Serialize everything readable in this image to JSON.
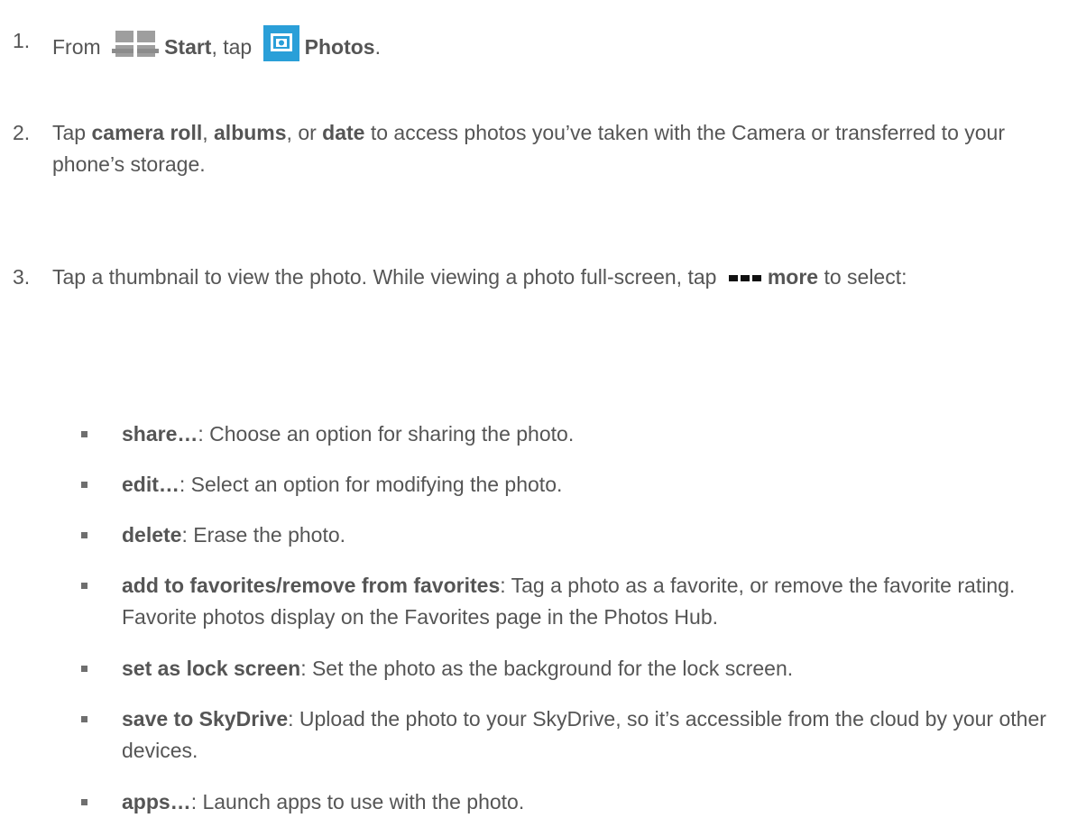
{
  "step1": {
    "num": "1.",
    "from": "From",
    "start": "Start",
    "mid": ", tap",
    "photos": "Photos",
    "end": ".",
    "start_icon": "windows-start-icon",
    "photos_icon": "photos-camera-icon"
  },
  "step2": {
    "num": "2.",
    "pre": "Tap ",
    "b1": "camera roll",
    "sep1": ", ",
    "b2": "albums",
    "sep2": ", or ",
    "b3": "date",
    "rest": " to access photos you’ve taken with the Camera or transferred to your phone’s storage."
  },
  "step3": {
    "num": "3.",
    "pre": "Tap a thumbnail to view the photo. While viewing a photo full-screen, tap",
    "more": "more",
    "post": " to select:",
    "more_icon": "more-dots-icon"
  },
  "bullets": [
    {
      "term": "share…",
      "desc": ": Choose an option for sharing the photo."
    },
    {
      "term": "edit…",
      "desc": ": Select an option for modifying the photo."
    },
    {
      "term": "delete",
      "desc": ": Erase the photo."
    },
    {
      "term": "add to favorites/remove from favorites",
      "desc": ": Tag a photo as a favorite, or remove the favorite rating. Favorite photos display on the Favorites page in the Photos Hub."
    },
    {
      "term": "set as lock screen",
      "desc": ": Set the photo as the background for the lock screen."
    },
    {
      "term": "save to SkyDrive",
      "desc": ": Upload the photo to your SkyDrive, so it’s accessible from the cloud by your other devices."
    },
    {
      "term": "apps…",
      "desc": ": Launch apps to use with the photo."
    }
  ],
  "colors": {
    "text": "#555555",
    "icon_blue": "#2a9fd8",
    "bullet": "#6f6f6f"
  }
}
